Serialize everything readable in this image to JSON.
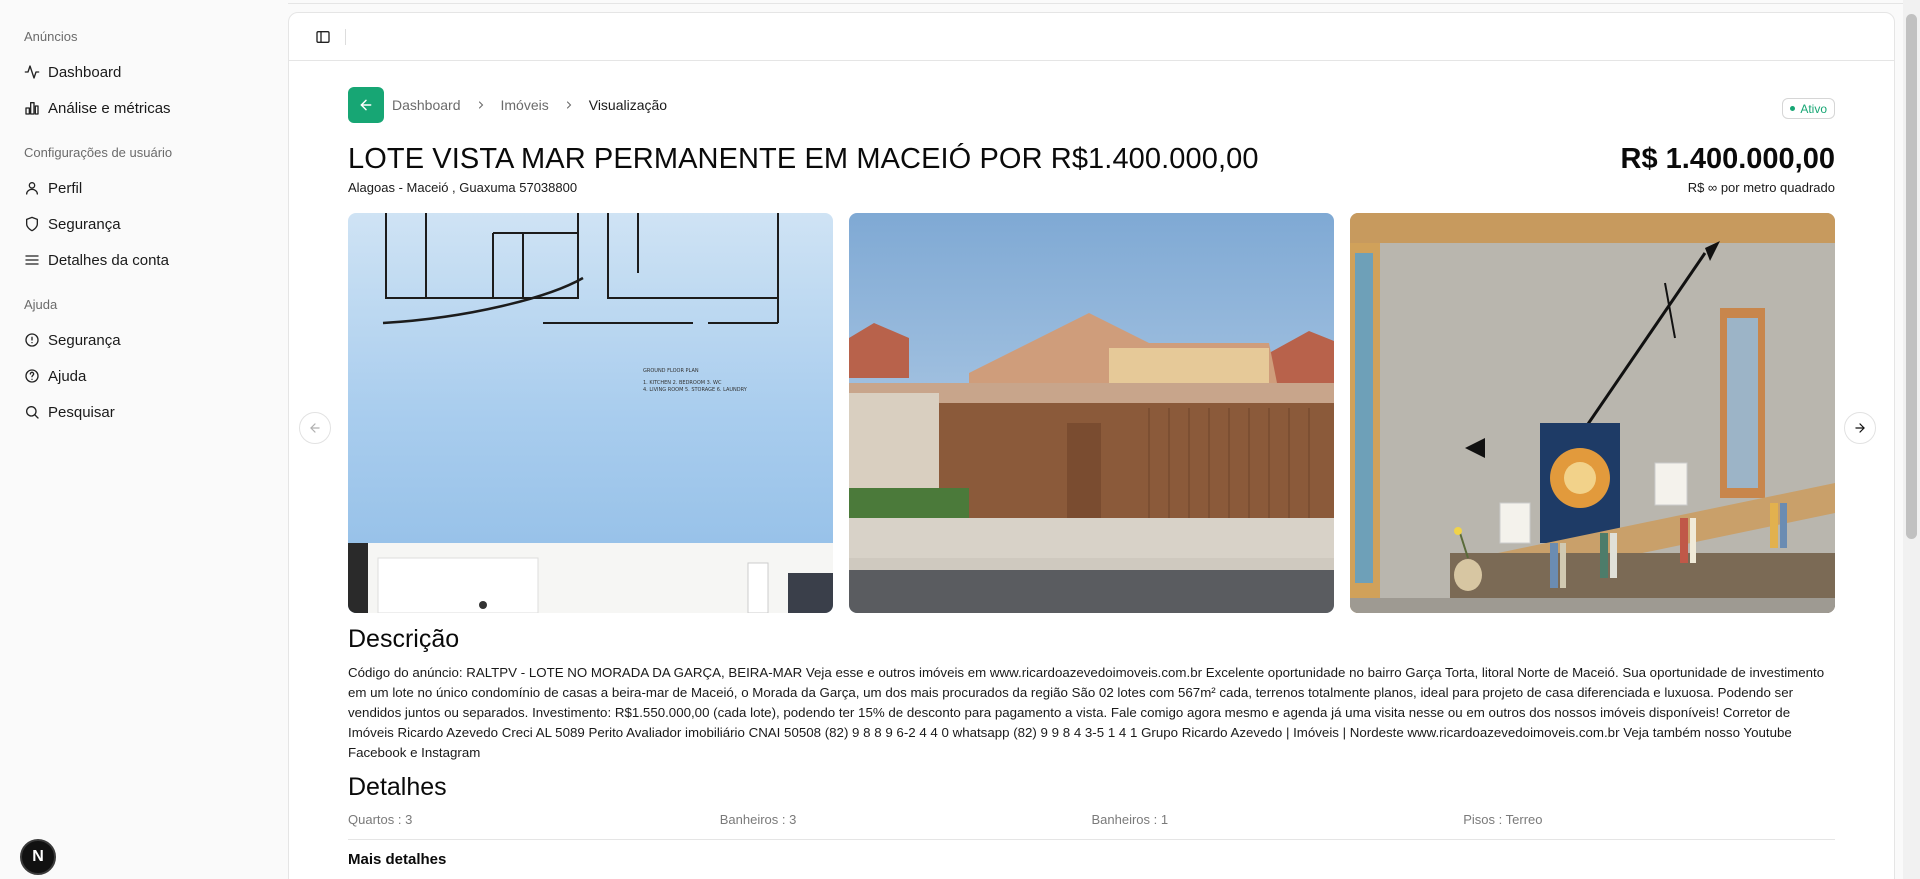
{
  "sidebar": {
    "groups": [
      {
        "label": "Anúncios",
        "items": [
          {
            "label": "Dashboard",
            "icon": "activity-icon"
          },
          {
            "label": "Análise e métricas",
            "icon": "bar-chart-icon"
          }
        ]
      },
      {
        "label": "Configurações de usuário",
        "items": [
          {
            "label": "Perfil",
            "icon": "user-icon"
          },
          {
            "label": "Segurança",
            "icon": "shield-icon"
          },
          {
            "label": "Detalhes da conta",
            "icon": "menu-icon"
          }
        ]
      },
      {
        "label": "Ajuda",
        "items": [
          {
            "label": "Segurança",
            "icon": "info-icon"
          },
          {
            "label": "Ajuda",
            "icon": "help-circle-icon"
          },
          {
            "label": "Pesquisar",
            "icon": "search-icon"
          }
        ]
      }
    ],
    "fab_label": "N"
  },
  "breadcrumb": {
    "items": [
      "Dashboard",
      "Imóveis",
      "Visualização"
    ]
  },
  "status": {
    "label": "Ativo",
    "color": "#17a674"
  },
  "listing": {
    "title": "LOTE VISTA MAR PERMANENTE EM MACEIÓ POR R$1.400.000,00",
    "address": "Alagoas - Maceió , Guaxuma 57038800",
    "price": "R$ 1.400.000,00",
    "price_per_m2": "R$ ∞ por metro quadrado"
  },
  "sections": {
    "description_title": "Descrição",
    "description": "Código do anúncio: RALTPV - LOTE NO MORADA DA GARÇA, BEIRA-MAR Veja esse e outros imóveis em www.ricardoazevedoimoveis.com.br Excelente oportunidade no bairro Garça Torta, litoral Norte de Maceió. Sua oportunidade de investimento em um lote no único condomínio de casas a beira-mar de Maceió, o Morada da Garça, um dos mais procurados da região São 02 lotes com 567m² cada, terrenos totalmente planos, ideal para projeto de casa diferenciada e luxuosa. Podendo ser vendidos juntos ou separados. Investimento: R$1.550.000,00 (cada lote), podendo ter 15% de desconto para pagamento a vista. Fale comigo agora mesmo e agenda já uma visita nesse ou em outros dos nossos imóveis disponíveis! Corretor de Imóveis Ricardo Azevedo Creci AL 5089 Perito Avaliador imobiliário CNAI 50508 (82) 9 8 8 9 6-2 4 4 0 whatsapp (82) 9 9 8 4 3-5 1 4 1 Grupo Ricardo Azevedo | Imóveis | Nordeste www.ricardoazevedoimoveis.com.br Veja também nosso Youtube Facebook e Instagram",
    "details_title": "Detalhes",
    "details": [
      "Quartos : 3",
      "Banheiros : 3",
      "Banheiros : 1",
      "Pisos : Terreo"
    ],
    "more_title": "Mais detalhes"
  },
  "gallery": {
    "images": [
      "floor-plan-house-photo",
      "brick-house-facade-photo",
      "interior-living-room-photo"
    ]
  },
  "colors": {
    "accent": "#17a674"
  }
}
